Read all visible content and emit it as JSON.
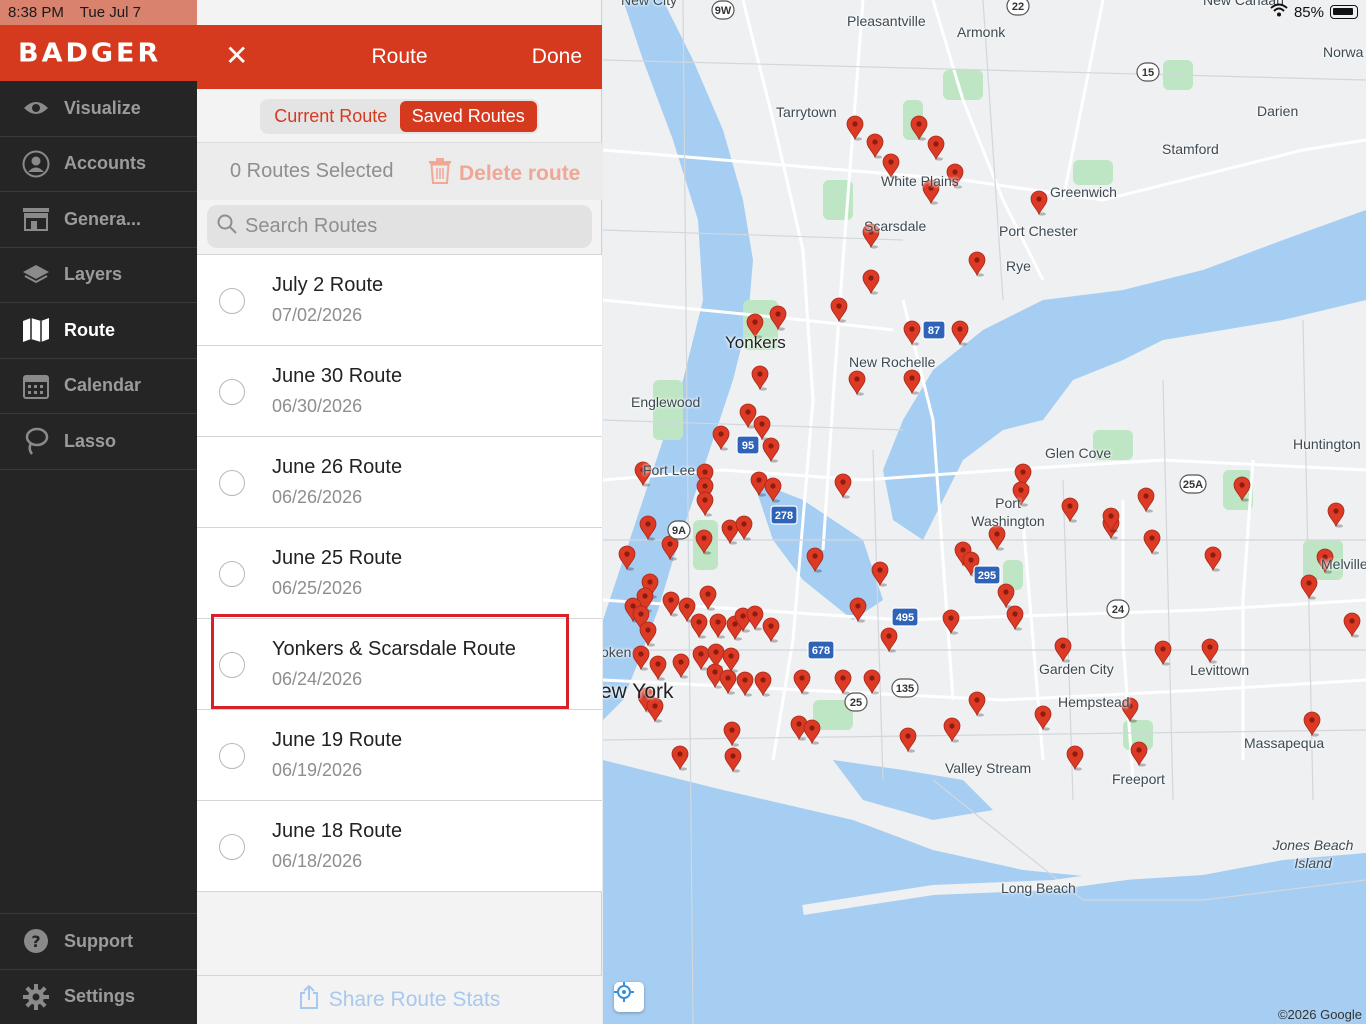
{
  "status": {
    "time": "8:38 PM",
    "date": "Tue Jul 7",
    "battery": "85%"
  },
  "brand": {
    "name": "BADGER"
  },
  "nav": {
    "items": [
      {
        "label": "Visualize",
        "icon": "eye-icon"
      },
      {
        "label": "Accounts",
        "icon": "user-circle-icon"
      },
      {
        "label": "Genera...",
        "icon": "storefront-icon"
      },
      {
        "label": "Layers",
        "icon": "layers-icon"
      },
      {
        "label": "Route",
        "icon": "map-icon",
        "active": true
      },
      {
        "label": "Calendar",
        "icon": "calendar-icon"
      },
      {
        "label": "Lasso",
        "icon": "lasso-icon"
      }
    ],
    "bottom": [
      {
        "label": "Support",
        "icon": "question-icon"
      },
      {
        "label": "Settings",
        "icon": "gear-icon"
      }
    ]
  },
  "panel": {
    "title": "Route",
    "close_label": "✕",
    "done_label": "Done",
    "tabs": {
      "current": "Current Route",
      "saved": "Saved Routes"
    },
    "selected_count": "0 Routes Selected",
    "delete_label": "Delete route",
    "search_placeholder": "Search Routes",
    "routes": [
      {
        "name": "July 2 Route",
        "date": "07/02/2026"
      },
      {
        "name": "June 30 Route",
        "date": "06/30/2026"
      },
      {
        "name": "June 26 Route",
        "date": "06/26/2026"
      },
      {
        "name": "June 25 Route",
        "date": "06/25/2026"
      },
      {
        "name": "Yonkers & Scarsdale Route",
        "date": "06/24/2026"
      },
      {
        "name": "June 19 Route",
        "date": "06/19/2026"
      },
      {
        "name": "June 18 Route",
        "date": "06/18/2026"
      }
    ],
    "share_label": "Share Route Stats"
  },
  "map": {
    "places": {
      "pleasantville": "Pleasantville",
      "armonk": "Armonk",
      "tarrytown": "Tarrytown",
      "darien": "Darien",
      "stamford": "Stamford",
      "white_plains": "White Plains",
      "greenwich": "Greenwich",
      "scarsdale": "Scarsdale",
      "port_chester": "Port Chester",
      "rye": "Rye",
      "yonkers": "Yonkers",
      "new_rochelle": "New Rochelle",
      "englewood": "Englewood",
      "glen_cove": "Glen Cove",
      "huntington": "Huntington",
      "fort_lee": "Fort Lee",
      "port_washington": "Port Washington",
      "melville": "Melville",
      "new_york": "ew York",
      "oken": "oken",
      "garden_city": "Garden City",
      "levittown": "Levittown",
      "hempstead": "Hempstead",
      "massapequa": "Massapequa",
      "valley_stream": "Valley Stream",
      "freeport": "Freeport",
      "jones_beach": "Jones Beach Island",
      "long_beach": "Long Beach",
      "norwa": "Norwa",
      "new_city": "New City",
      "new_canaan": "New Canaan"
    },
    "highways": [
      "9W",
      "22",
      "15",
      "87",
      "95",
      "278",
      "9A",
      "25A",
      "295",
      "495",
      "678",
      "25",
      "24",
      "135"
    ],
    "copyright": "©2026 Google",
    "pin_color": "#dc3a24",
    "water_color": "#a6cef2",
    "park_color": "#bfe6c4"
  }
}
